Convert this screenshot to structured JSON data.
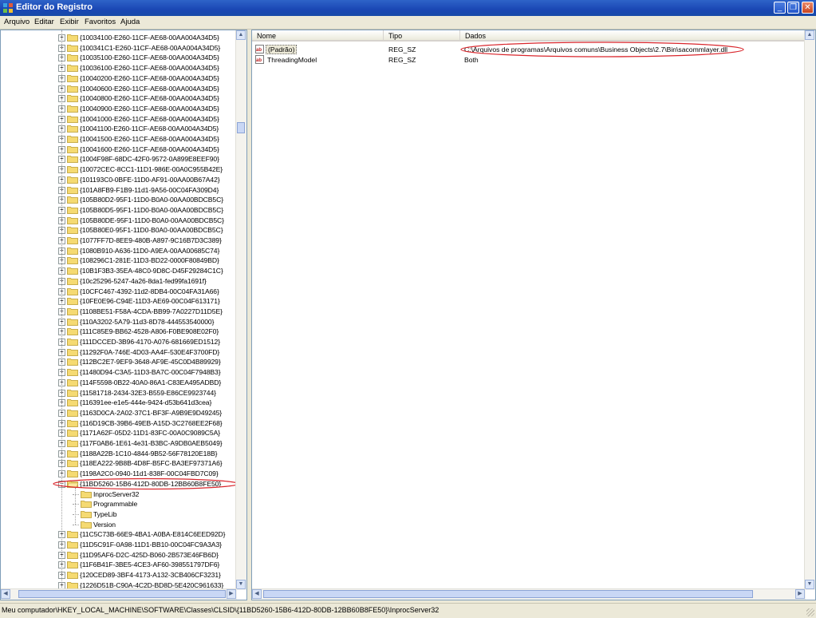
{
  "window": {
    "title": "Editor do Registro",
    "min_label": "_",
    "max_label": "❐",
    "close_label": "✕"
  },
  "menu": [
    "Arquivo",
    "Editar",
    "Exibir",
    "Favoritos",
    "Ajuda"
  ],
  "tree": {
    "keys": [
      "{10034100-E260-11CF-AE68-00AA004A34D5}",
      "{100341C1-E260-11CF-AE68-00AA004A34D5}",
      "{10035100-E260-11CF-AE68-00AA004A34D5}",
      "{10036100-E260-11CF-AE68-00AA004A34D5}",
      "{10040200-E260-11CF-AE68-00AA004A34D5}",
      "{10040600-E260-11CF-AE68-00AA004A34D5}",
      "{10040800-E260-11CF-AE68-00AA004A34D5}",
      "{10040900-E260-11CF-AE68-00AA004A34D5}",
      "{10041000-E260-11CF-AE68-00AA004A34D5}",
      "{10041100-E260-11CF-AE68-00AA004A34D5}",
      "{10041500-E260-11CF-AE68-00AA004A34D5}",
      "{10041600-E260-11CF-AE68-00AA004A34D5}",
      "{1004F98F-68DC-42F0-9572-0A899E8EEF90}",
      "{10072CEC-8CC1-11D1-986E-00A0C955B42E}",
      "{101193C0-0BFE-11D0-AF91-00AA00B67A42}",
      "{101A8FB9-F1B9-11d1-9A56-00C04FA309D4}",
      "{105B80D2-95F1-11D0-B0A0-00AA00BDCB5C}",
      "{105B80D5-95F1-11D0-B0A0-00AA00BDCB5C}",
      "{105B80DE-95F1-11D0-B0A0-00AA00BDCB5C}",
      "{105B80E0-95F1-11D0-B0A0-00AA00BDCB5C}",
      "{1077FF7D-8EE9-480B-A897-9C16B7D3C389}",
      "{1080B910-A636-11D0-A9EA-00AA00685C74}",
      "{108296C1-281E-11D3-BD22-0000F80849BD}",
      "{10B1F3B3-35EA-48C0-9D8C-D45F29284C1C}",
      "{10c25296-5247-4a26-8da1-fed99fa1691f}",
      "{10CFC467-4392-11d2-8DB4-00C04FA31A66}",
      "{10FE0E96-C94E-11D3-AE69-00C04F613171}",
      "{1108BE51-F58A-4CDA-BB99-7A0227D11D5E}",
      "{110A3202-5A79-11d3-8D78-444553540000}",
      "{111C85E9-BB62-4528-A806-F0BE908E02F0}",
      "{111DCCED-3B96-4170-A076-681669ED1512}",
      "{11292F0A-746E-4D03-AA4F-530E4F3700FD}",
      "{112BC2E7-9EF9-3648-AF9E-45C0D4B89929}",
      "{11480D94-C3A5-11D3-BA7C-00C04F7948B3}",
      "{114F5598-0B22-40A0-86A1-C83EA495ADBD}",
      "{11581718-2434-32E3-B559-E86CE9923744}",
      "{116391ee-e1e5-444e-9424-d53b641d3cea}",
      "{1163D0CA-2A02-37C1-BF3F-A9B9E9D49245}",
      "{116D19CB-39B6-49EB-A15D-3C2768EE2F68}",
      "{1171A62F-05D2-11D1-83FC-00A0C9089C5A}",
      "{117F0AB6-1E61-4e31-B3BC-A9DB0AEB5049}",
      "{1188A22B-1C10-4844-9B52-56F78120E18B}",
      "{118EA222-9B8B-4D8F-B5FC-BA3EF97371A6}",
      "{1198A2C0-0940-11d1-838F-00C04FBD7C09}",
      "{11BD5260-15B6-412D-80DB-12BB60B8FE50}"
    ],
    "subkeys": [
      "InprocServer32",
      "Programmable",
      "TypeLib",
      "Version"
    ],
    "keys_after": [
      "{11C5C73B-66E9-4BA1-A0BA-E814C6EED92D}",
      "{11D5C91F-0A98-11D1-BB10-00C04FC9A3A3}",
      "{11D95AF6-D2C-425D-B060-2B573E46FB6D}",
      "{11F6B41F-3BE5-4CE3-AF60-398551797DF6}",
      "{120CED89-3BF4-4173-A132-3CB406CF3231}",
      "{1226D51B-C90A-4C2D-BD8D-5E420C961633}"
    ]
  },
  "list": {
    "columns": [
      "Nome",
      "Tipo",
      "Dados"
    ],
    "rows": [
      {
        "name": "(Padrão)",
        "type": "REG_SZ",
        "data": "C:\\Arquivos de programas\\Arquivos comuns\\Business Objects\\2.7\\Bin\\sacommlayer.dll"
      },
      {
        "name": "ThreadingModel",
        "type": "REG_SZ",
        "data": "Both"
      }
    ]
  },
  "status_text": "Meu computador\\HKEY_LOCAL_MACHINE\\SOFTWARE\\Classes\\CLSID\\{11BD5260-15B6-412D-80DB-12BB60B8FE50}\\InprocServer32",
  "colors": {
    "titlebar": "#1A47B4",
    "annotation": "#D9262C",
    "folder": "#F5DA72"
  },
  "icons": {
    "folder": "folder-icon",
    "string_value": "string-value-icon",
    "app": "registry-editor-icon"
  }
}
